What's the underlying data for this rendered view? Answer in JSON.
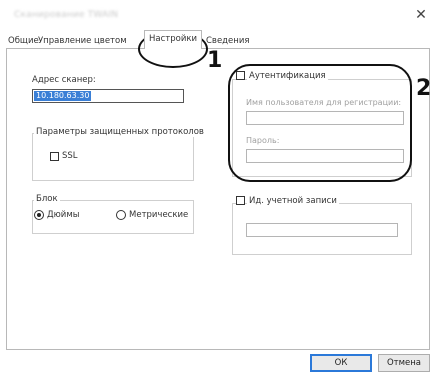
{
  "window": {
    "title": "Сканирование TWAIN"
  },
  "tabs": [
    {
      "label": "Общие"
    },
    {
      "label": "Управление цветом"
    },
    {
      "label": "Настройки"
    },
    {
      "label": "Сведения"
    }
  ],
  "scanner": {
    "address_label": "Адрес сканер:",
    "address_value": "10.180.63.30"
  },
  "protocols": {
    "title": "Параметры защищенных протоколов",
    "ssl_label": "SSL"
  },
  "units": {
    "title": "Блок",
    "inches_label": "Дюймы",
    "metric_label": "Метрические",
    "selected": "inches"
  },
  "auth": {
    "checkbox_label": "Аутентификация",
    "username_label": "Имя пользователя для регистрации:",
    "password_label": "Пароль:"
  },
  "account": {
    "checkbox_label": "Ид. учетной записи"
  },
  "callouts": {
    "one": "1",
    "two": "2"
  },
  "buttons": {
    "ok": "ОК",
    "cancel": "Отмена"
  }
}
